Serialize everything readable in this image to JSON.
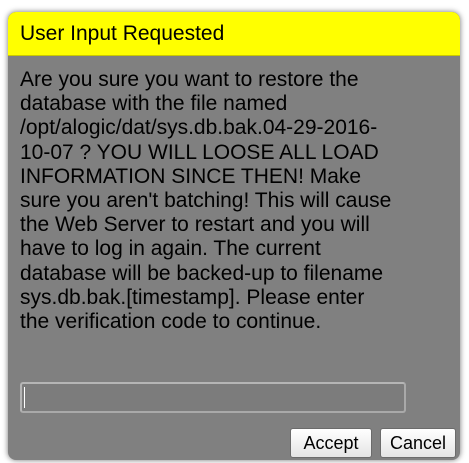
{
  "dialog": {
    "title": "User Input Requested",
    "message": "Are you sure you want to restore the\ndatabase with the file named\n/opt/alogic/dat/sys.db.bak.04-29-2016-\n10-07 ? YOU WILL LOOSE ALL LOAD\nINFORMATION SINCE THEN! Make\nsure you aren't batching! This will cause\nthe Web Server to restart and you will\nhave to log in again. The current\ndatabase will be backed-up to filename\nsys.db.bak.[timestamp]. Please enter\nthe verification code to continue.",
    "input_value": "",
    "accept_label": "Accept",
    "cancel_label": "Cancel"
  },
  "colors": {
    "title_bar": "#ffff00",
    "dialog_body": "#808080",
    "input_background": "#7c7c7c"
  }
}
